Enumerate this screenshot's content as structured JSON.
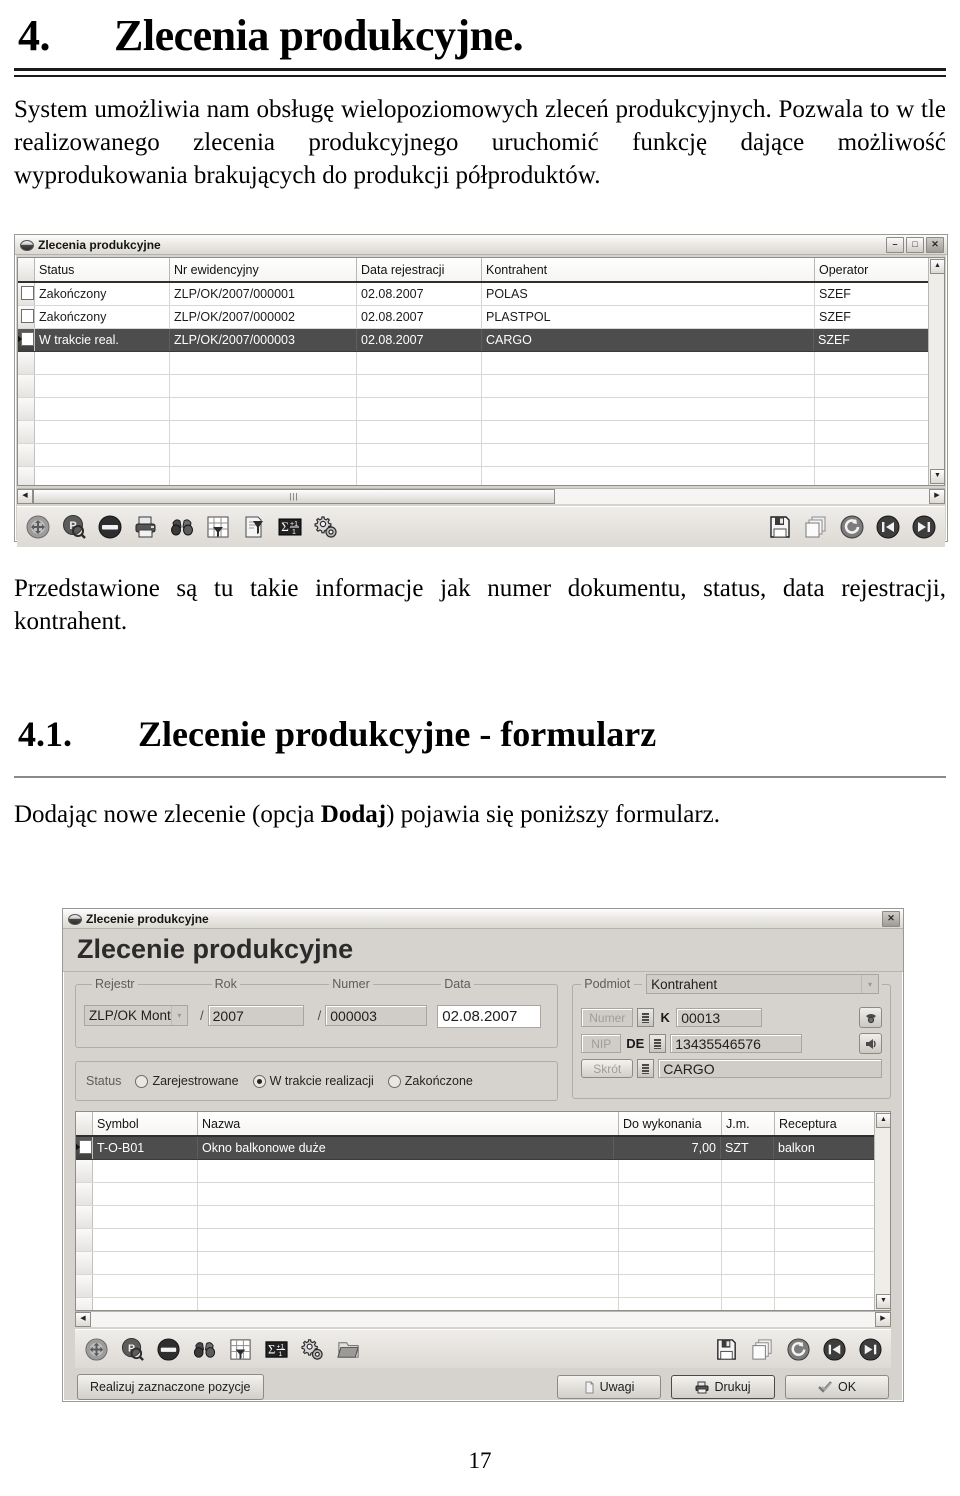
{
  "document": {
    "heading1_number": "4.",
    "heading1_text": "Zlecenia produkcyjne.",
    "intro_paragraph": "System umożliwia nam obsługę wielopoziomowych zleceń produkcyjnych. Pozwala to w tle realizowanego zlecenia produkcyjnego uruchomić funkcję dające możliwość wyprodukowania brakujących do produkcji półproduktów.",
    "mid_paragraph": "Przedstawione są tu takie informacje jak numer dokumentu, status, data rejestracji, kontrahent.",
    "heading2_number": "4.1.",
    "heading2_text": "Zlecenie produkcyjne - formularz",
    "closing_prefix": "Dodając nowe zlecenie (opcja ",
    "closing_bold": "Dodaj",
    "closing_suffix": ") pojawia się poniższy formularz.",
    "page_number": "17"
  },
  "list_window": {
    "title": "Zlecenia produkcyjne",
    "buttons": {
      "minimize": "–",
      "maximize": "□",
      "close": "✕"
    },
    "grid": {
      "columns": [
        "Status",
        "Nr ewidencyjny",
        "Data rejestracji",
        "Kontrahent",
        "Operator"
      ],
      "rows": [
        {
          "status": "Zakończony",
          "nr": "ZLP/OK/2007/000001",
          "data": "02.08.2007",
          "kontrahent": "POLAS",
          "operator": "SZEF",
          "selected": false
        },
        {
          "status": "Zakończony",
          "nr": "ZLP/OK/2007/000002",
          "data": "02.08.2007",
          "kontrahent": "PLASTPOL",
          "operator": "SZEF",
          "selected": false
        },
        {
          "status": "W trakcie real.",
          "nr": "ZLP/OK/2007/000003",
          "data": "02.08.2007",
          "kontrahent": "CARGO",
          "operator": "SZEF",
          "selected": true
        }
      ],
      "empty_row_count": 6
    },
    "toolbar_icons": [
      "add-icon",
      "edit-search-icon",
      "delete-icon",
      "print-icon",
      "binoculars-icon",
      "grid-filter-icon",
      "report-filter-icon",
      "sum-icon",
      "gears-icon",
      "save-icon",
      "copy-icon",
      "refresh-icon",
      "first-record-icon",
      "last-record-icon"
    ]
  },
  "form_window": {
    "title": "Zlecenie produkcyjne",
    "banner": "Zlecenie produkcyjne",
    "close_button": "✕",
    "doc_group": {
      "labels": {
        "rejestr": "Rejestr",
        "rok": "Rok",
        "numer": "Numer",
        "data": "Data"
      },
      "separators": [
        "/",
        "/"
      ],
      "values": {
        "rejestr": "ZLP/OK Mont",
        "rok": "2007",
        "numer": "000003",
        "data": "02.08.2007"
      }
    },
    "status_group": {
      "label": "Status",
      "options": [
        {
          "label": "Zarejestrowane",
          "selected": false
        },
        {
          "label": "W trakcie realizacji",
          "selected": true
        },
        {
          "label": "Zakończone",
          "selected": false
        }
      ]
    },
    "podmiot_group": {
      "legend": "Podmiot",
      "type_value": "Kontrahent",
      "rows": [
        {
          "label": "Numer",
          "prefix": "K",
          "value": "00013"
        },
        {
          "label": "NIP",
          "prefix": "DE",
          "value": "13435546576"
        },
        {
          "label": "Skrót",
          "prefix": "",
          "value": "CARGO"
        }
      ],
      "side_buttons": [
        "phone-icon",
        "speaker-icon"
      ]
    },
    "grid": {
      "columns": [
        "Symbol",
        "Nazwa",
        "Do wykonania",
        "J.m.",
        "Receptura"
      ],
      "rows": [
        {
          "symbol": "T-O-B01",
          "nazwa": "Okno balkonowe duże",
          "do_wykonania": "7,00",
          "jm": "SZT",
          "receptura": "balkon",
          "selected": true
        }
      ],
      "empty_row_count": 8
    },
    "toolbar_icons": [
      "add-icon",
      "edit-search-icon",
      "delete-icon",
      "binoculars-icon",
      "grid-filter-icon",
      "sum-icon",
      "gears-icon",
      "folder-icon",
      "save-icon",
      "copy-icon",
      "refresh-icon",
      "first-record-icon",
      "last-record-icon"
    ],
    "footer": {
      "realize_label": "Realizuj zaznaczone pozycje",
      "uwagi_label": "Uwagi",
      "drukuj_label": "Drukuj",
      "ok_label": "OK"
    }
  },
  "colors": {
    "window_face": "#d6d3ce",
    "selection": "#4d4d4d",
    "text": "#1b1b1b",
    "field": "#d0cdc8"
  }
}
